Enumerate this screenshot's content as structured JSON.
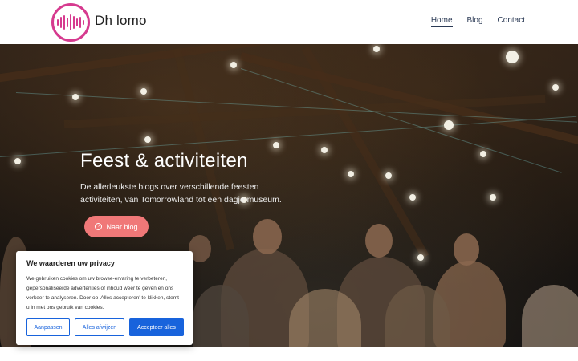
{
  "header": {
    "site_title": "Dh lomo",
    "logo_icon": "equalizer-icon",
    "brand_color": "#d63a8f",
    "nav": [
      {
        "label": "Home",
        "active": true
      },
      {
        "label": "Blog",
        "active": false
      },
      {
        "label": "Contact",
        "active": false
      }
    ]
  },
  "hero": {
    "title": "Feest & activiteiten",
    "subtitle": "De allerleukste blogs over verschillende feesten activiteiten, van Tomorrowland tot een dagje museum.",
    "button_label": "Naar blog",
    "button_icon": "arrow-circle-right-icon",
    "button_color": "#f07878"
  },
  "cookie": {
    "title": "We waarderen uw privacy",
    "text": "We gebruiken cookies om uw browse-ervaring te verbeteren, gepersonaliseerde advertenties of inhoud weer te geven en ons verkeer te analyseren. Door op 'Alles accepteren' te klikken, stemt u in met ons gebruik van cookies.",
    "customize_label": "Aanpassen",
    "reject_label": "Alles afwijzen",
    "accept_label": "Accepteer alles",
    "accent_color": "#1863dc"
  }
}
